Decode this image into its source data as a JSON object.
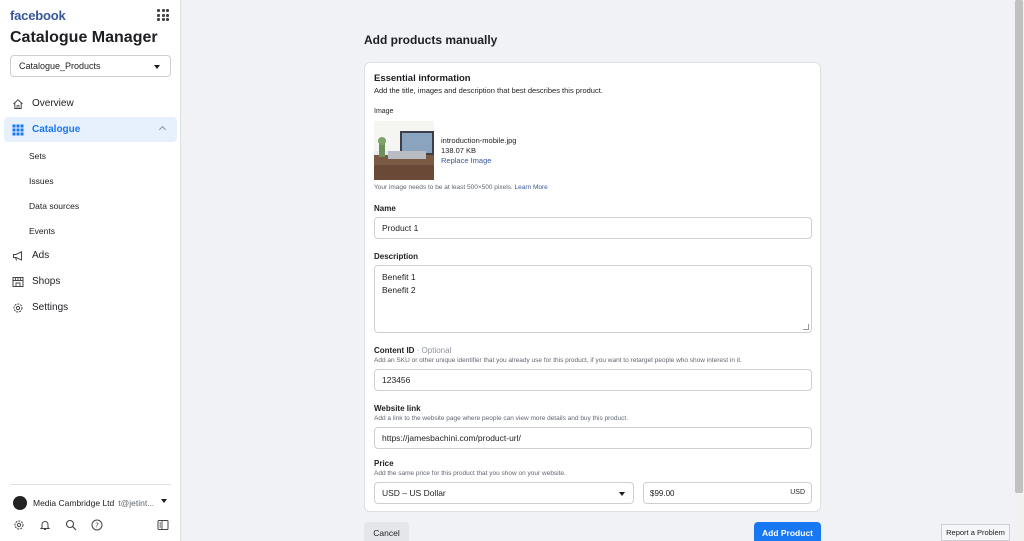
{
  "sidebar": {
    "brand": "facebook",
    "app_title": "Catalogue Manager",
    "catalog_select": "Catalogue_Products",
    "nav": [
      {
        "label": "Overview",
        "icon": "home-icon"
      },
      {
        "label": "Catalogue",
        "icon": "grid-icon",
        "active": true
      },
      {
        "label": "Ads",
        "icon": "megaphone-icon"
      },
      {
        "label": "Shops",
        "icon": "shop-icon"
      },
      {
        "label": "Settings",
        "icon": "gear-icon"
      }
    ],
    "sub_nav": [
      "Sets",
      "Issues",
      "Data sources",
      "Events"
    ],
    "account": {
      "name": "Media Cambridge Ltd",
      "handle": "t@jetint..."
    }
  },
  "main": {
    "title": "Add products manually",
    "essential": {
      "title": "Essential information",
      "subtitle": "Add the title, images and description that best describes this product."
    },
    "image": {
      "label": "Image",
      "file_name": "introduction-mobile.jpg",
      "file_size": "138.07 KB",
      "replace_label": "Replace Image",
      "help": "Your image needs to be at least 500×500 pixels.",
      "learn_more": "Learn More"
    },
    "name": {
      "label": "Name",
      "value": "Product 1"
    },
    "description": {
      "label": "Description",
      "line1": "Benefit 1",
      "line2": "Benefit 2"
    },
    "content_id": {
      "label": "Content ID",
      "optional": "· Optional",
      "help": "Add an SKU or other unique identifier that you already use for this product, if you want to retarget people who show interest in it.",
      "value": "123456"
    },
    "website": {
      "label": "Website link",
      "help": "Add a link to the website page where people can view more details and buy this product.",
      "value": "https://jamesbachini.com/product-url/"
    },
    "price": {
      "label": "Price",
      "help": "Add the same price for this product that you show on your website.",
      "currency": "USD – US Dollar",
      "value": "$99.00",
      "unit": "USD"
    },
    "cancel_label": "Cancel",
    "add_label": "Add Product"
  },
  "report_label": "Report a Problem",
  "colors": {
    "accent": "#1877f2",
    "brand": "#385898",
    "active_bg": "#e7f0fd"
  }
}
